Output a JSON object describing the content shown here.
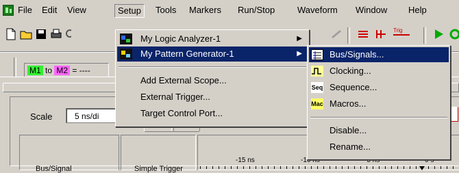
{
  "menubar": {
    "items": [
      {
        "label": "File"
      },
      {
        "label": "Edit"
      },
      {
        "label": "View"
      },
      {
        "label": "Setup"
      },
      {
        "label": "Tools"
      },
      {
        "label": "Markers"
      },
      {
        "label": "Run/Stop"
      },
      {
        "label": "Waveform"
      },
      {
        "label": "Window"
      },
      {
        "label": "Help"
      }
    ]
  },
  "markers": {
    "m1": "M1",
    "to": "to",
    "m2": "M2",
    "value": "= ----"
  },
  "toolbar": {
    "trig_label": "Trig"
  },
  "panel": {
    "scale_label": "Scale",
    "scale_value": "5 ns/di",
    "col_bus_signal": "Bus/Signal",
    "col_simple_trigger": "Simple Trigger",
    "time_ticks": [
      "-15 ns",
      "-10 ns",
      "-5 ns",
      "0 s"
    ]
  },
  "setup_menu": {
    "items": [
      {
        "label": "My Logic Analyzer-1",
        "icon": "logic-analyzer-icon",
        "submenu": true
      },
      {
        "label": "My Pattern Generator-1",
        "icon": "pattern-generator-icon",
        "submenu": true,
        "highlighted": true
      },
      {
        "label": "Add External Scope..."
      },
      {
        "label": "External Trigger..."
      },
      {
        "label": "Target Control Port..."
      }
    ]
  },
  "submenu": {
    "items": [
      {
        "label": "Bus/Signals...",
        "icon": "bus-signals-icon",
        "highlighted": true
      },
      {
        "label": "Clocking...",
        "icon": "clock-icon"
      },
      {
        "label": "Sequence...",
        "icon": "sequence-icon",
        "icon_text": "Seq"
      },
      {
        "label": "Macros...",
        "icon": "macro-icon",
        "icon_text": "Mac"
      },
      {
        "label": "Disable..."
      },
      {
        "label": "Rename..."
      }
    ]
  },
  "colors": {
    "highlight": "#0a246a",
    "m1": "#33ee33",
    "m2": "#ff66ff",
    "window": "#d4d0c8"
  }
}
